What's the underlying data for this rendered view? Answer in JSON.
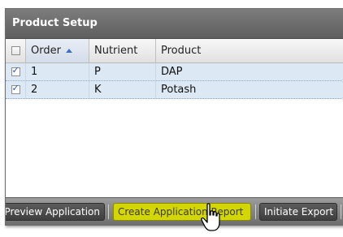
{
  "window": {
    "title": "Product Setup"
  },
  "grid": {
    "columns": [
      {
        "label": "Order",
        "sorted": "ascending"
      },
      {
        "label": "Nutrient"
      },
      {
        "label": "Product"
      }
    ],
    "rows": [
      {
        "checked": true,
        "order": "1",
        "nutrient": "P",
        "product": "DAP"
      },
      {
        "checked": true,
        "order": "2",
        "nutrient": "K",
        "product": "Potash"
      }
    ]
  },
  "toolbar": {
    "buttons": [
      {
        "label": "Preview Application",
        "highlighted": false
      },
      {
        "label": "Create Application Report",
        "highlighted": true
      },
      {
        "label": "Initiate Export",
        "highlighted": false
      }
    ]
  },
  "colors": {
    "highlight": "#d4d600",
    "row_selected": "#dde8f5",
    "title_bar": "#6a6a6a"
  }
}
